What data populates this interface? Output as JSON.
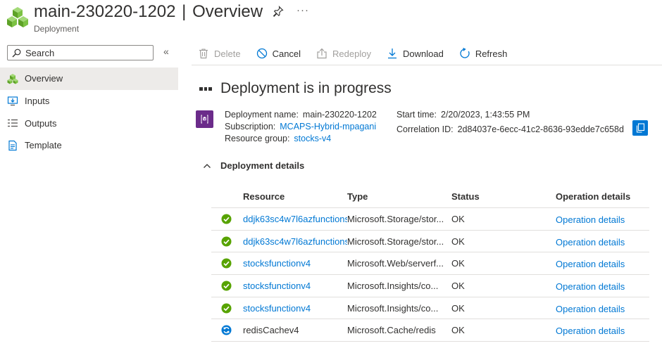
{
  "header": {
    "title": "main-230220-1202",
    "separator": "|",
    "section": "Overview",
    "subtitle": "Deployment",
    "more": "···"
  },
  "sidebar": {
    "search_placeholder": "Search",
    "collapse": "«",
    "items": [
      {
        "label": "Overview",
        "icon": "overview-icon",
        "active": true
      },
      {
        "label": "Inputs",
        "icon": "inputs-icon",
        "active": false
      },
      {
        "label": "Outputs",
        "icon": "outputs-icon",
        "active": false
      },
      {
        "label": "Template",
        "icon": "template-icon",
        "active": false
      }
    ]
  },
  "toolbar": {
    "delete": "Delete",
    "cancel": "Cancel",
    "redeploy": "Redeploy",
    "download": "Download",
    "refresh": "Refresh"
  },
  "main": {
    "title": "Deployment is in progress",
    "deployment_name_label": "Deployment name:",
    "deployment_name": "main-230220-1202",
    "subscription_label": "Subscription:",
    "subscription": "MCAPS-Hybrid-mpagani",
    "resource_group_label": "Resource group:",
    "resource_group": "stocks-v4",
    "start_time_label": "Start time:",
    "start_time": "2/20/2023, 1:43:55 PM",
    "correlation_id_label": "Correlation ID:",
    "correlation_id": "2d84037e-6ecc-41c2-8636-93edde7c658d",
    "details_label": "Deployment details"
  },
  "table": {
    "headers": {
      "resource": "Resource",
      "type": "Type",
      "status": "Status",
      "operation": "Operation details"
    },
    "rows": [
      {
        "resource": "ddjk63sc4w7l6azfunctions",
        "resource_link": true,
        "type": "Microsoft.Storage/stor...",
        "status": "OK",
        "operation": "Operation details",
        "state": "success"
      },
      {
        "resource": "ddjk63sc4w7l6azfunctions",
        "resource_link": true,
        "type": "Microsoft.Storage/stor...",
        "status": "OK",
        "operation": "Operation details",
        "state": "success"
      },
      {
        "resource": "stocksfunctionv4",
        "resource_link": true,
        "type": "Microsoft.Web/serverf...",
        "status": "OK",
        "operation": "Operation details",
        "state": "success"
      },
      {
        "resource": "stocksfunctionv4",
        "resource_link": true,
        "type": "Microsoft.Insights/co...",
        "status": "OK",
        "operation": "Operation details",
        "state": "success"
      },
      {
        "resource": "stocksfunctionv4",
        "resource_link": true,
        "type": "Microsoft.Insights/co...",
        "status": "OK",
        "operation": "Operation details",
        "state": "success"
      },
      {
        "resource": "redisCachev4",
        "resource_link": false,
        "type": "Microsoft.Cache/redis",
        "status": "OK",
        "operation": "Operation details",
        "state": "in-progress"
      }
    ]
  },
  "colors": {
    "accent": "#0078d4",
    "success": "#57a300",
    "deployment_icon": "#6b2b8a",
    "selected_nav": "#edebe9"
  }
}
